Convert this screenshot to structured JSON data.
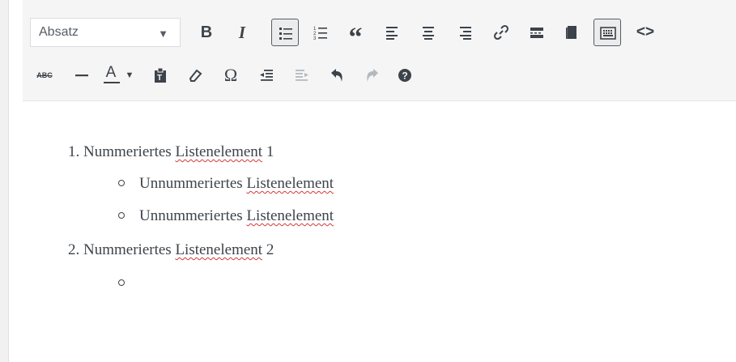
{
  "toolbar": {
    "format_select": {
      "value": "Absatz"
    },
    "colors": {
      "active_border": "#555d66",
      "text": "#3c434a",
      "disabled": "#b4b9be",
      "spellcheck": "#d63638"
    },
    "row1_buttons": [
      {
        "icon": "bold-icon",
        "label": "B"
      },
      {
        "icon": "italic-icon",
        "label": "I"
      },
      {
        "icon": "bulleted-list-icon",
        "active": true
      },
      {
        "icon": "numbered-list-icon"
      },
      {
        "icon": "blockquote-icon",
        "label": "“"
      },
      {
        "icon": "align-left-icon"
      },
      {
        "icon": "align-center-icon"
      },
      {
        "icon": "align-right-icon"
      },
      {
        "icon": "link-icon"
      },
      {
        "icon": "read-more-icon"
      },
      {
        "icon": "fullscreen-icon"
      },
      {
        "icon": "toolbar-toggle-icon",
        "active": true
      },
      {
        "icon": "code-icon",
        "label": "<>"
      }
    ],
    "row2_buttons": [
      {
        "icon": "strikethrough-icon",
        "label": "ABC"
      },
      {
        "icon": "horizontal-rule-icon"
      },
      {
        "icon": "text-color-icon",
        "label": "A"
      },
      {
        "icon": "paste-text-icon"
      },
      {
        "icon": "clear-formatting-icon"
      },
      {
        "icon": "special-character-icon",
        "label": "Ω"
      },
      {
        "icon": "outdent-icon"
      },
      {
        "icon": "indent-icon",
        "disabled": true
      },
      {
        "icon": "undo-icon"
      },
      {
        "icon": "redo-icon",
        "disabled": true
      },
      {
        "icon": "help-icon",
        "label": "?"
      }
    ]
  },
  "content": {
    "ordered_items": [
      {
        "number": "1.",
        "text_before": "Nummeriertes ",
        "misspelled": "Listenelement",
        "text_after": " 1"
      },
      {
        "number": "2.",
        "text_before": "Nummeriertes ",
        "misspelled": "Listenelement",
        "text_after": " 2"
      }
    ],
    "bullet_items": [
      {
        "text_before": "Unnummeriertes ",
        "misspelled": "Listenelement"
      },
      {
        "text_before": "Unnummeriertes ",
        "misspelled": "Listenelement"
      },
      {
        "text_before": "",
        "misspelled": ""
      }
    ]
  }
}
